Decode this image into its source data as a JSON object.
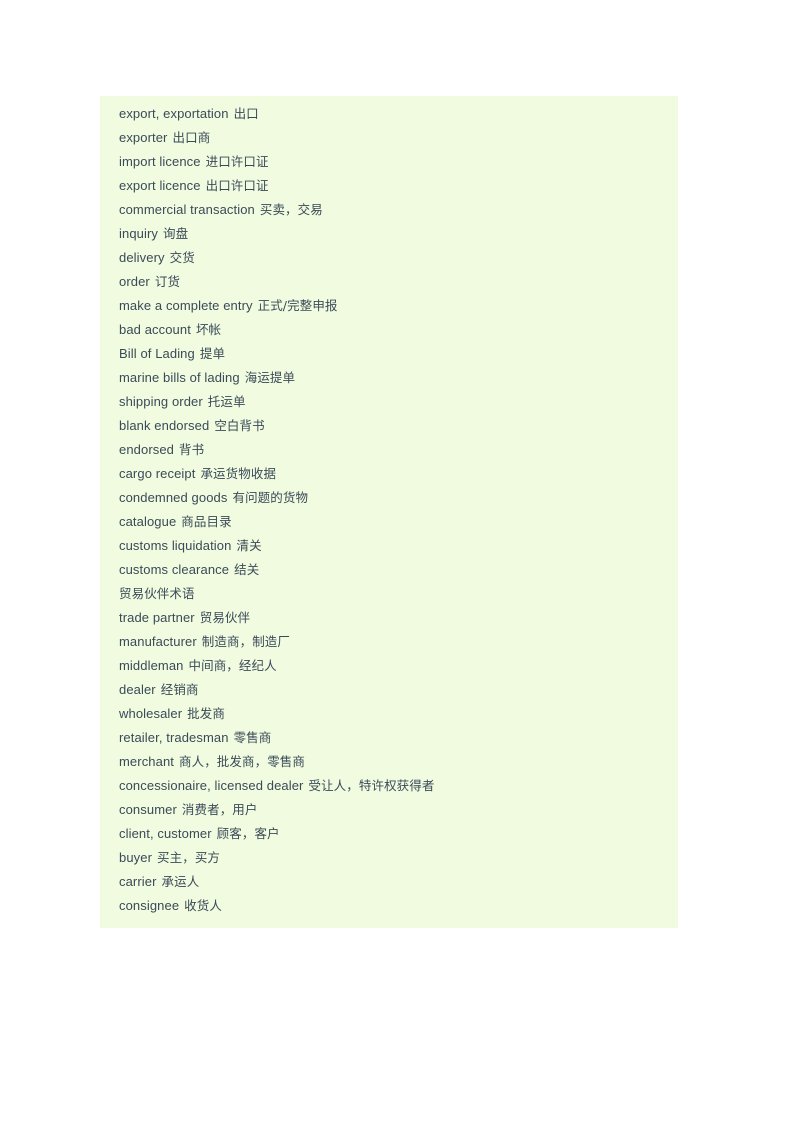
{
  "page": {
    "background_color": "#ffffff",
    "block_background_color": "#f1fbe0",
    "text_color": "#3a4a58"
  },
  "glossary": {
    "entries": [
      {
        "en": "export, exportation",
        "zh": "出口"
      },
      {
        "en": "exporter",
        "zh": "出口商"
      },
      {
        "en": "import licence",
        "zh": "进口许口证"
      },
      {
        "en": "export licence",
        "zh": "出口许口证"
      },
      {
        "en": "commercial transaction",
        "zh": "买卖，交易"
      },
      {
        "en": "inquiry",
        "zh": "询盘"
      },
      {
        "en": "delivery",
        "zh": "交货"
      },
      {
        "en": "order",
        "zh": "订货"
      },
      {
        "en": "make a complete entry",
        "zh": "正式/完整申报"
      },
      {
        "en": "bad account",
        "zh": "坏帐"
      },
      {
        "en": "Bill of Lading",
        "zh": "提单"
      },
      {
        "en": "marine bills of lading",
        "zh": "海运提单"
      },
      {
        "en": "shipping order",
        "zh": "托运单"
      },
      {
        "en": "blank endorsed",
        "zh": "空白背书"
      },
      {
        "en": "endorsed",
        "zh": "背书"
      },
      {
        "en": "cargo receipt",
        "zh": "承运货物收据"
      },
      {
        "en": "condemned goods",
        "zh": "有问题的货物"
      },
      {
        "en": "catalogue",
        "zh": "商品目录"
      },
      {
        "en": "customs liquidation",
        "zh": "清关"
      },
      {
        "en": "customs clearance",
        "zh": "结关"
      },
      {
        "en": "",
        "zh": "贸易伙伴术语"
      },
      {
        "en": "trade partner",
        "zh": "贸易伙伴"
      },
      {
        "en": "manufacturer",
        "zh": "制造商，制造厂"
      },
      {
        "en": "middleman",
        "zh": "中间商，经纪人"
      },
      {
        "en": "dealer",
        "zh": "经销商"
      },
      {
        "en": "wholesaler",
        "zh": "批发商"
      },
      {
        "en": "retailer, tradesman",
        "zh": "零售商"
      },
      {
        "en": "merchant",
        "zh": "商人，批发商，零售商"
      },
      {
        "en": "concessionaire, licensed dealer",
        "zh": "受让人，特许权获得者"
      },
      {
        "en": "consumer",
        "zh": "消费者，用户"
      },
      {
        "en": "client, customer",
        "zh": "顾客，客户"
      },
      {
        "en": "buyer",
        "zh": "买主，买方"
      },
      {
        "en": "carrier",
        "zh": "承运人"
      },
      {
        "en": "consignee",
        "zh": "收货人"
      }
    ]
  }
}
